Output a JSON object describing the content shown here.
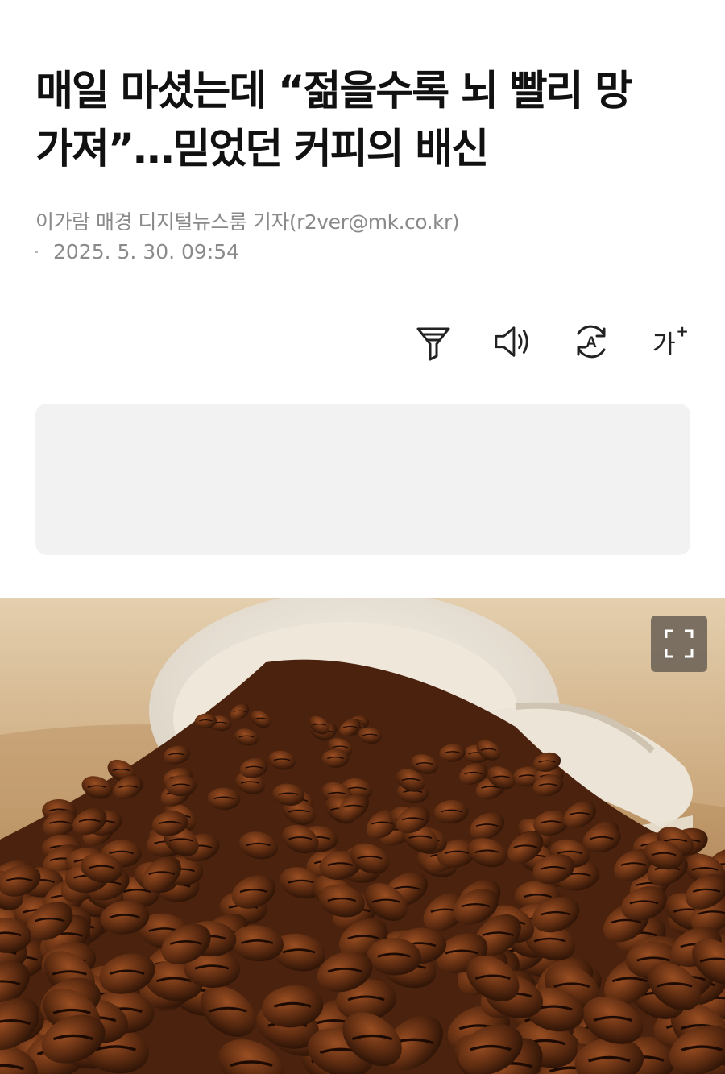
{
  "article": {
    "headline_line1": "매일 마셨는데 “젊을수록 뇌 빨리 망",
    "headline_line2": "가져”…믿었던 커피의 배신",
    "byline": "이가람 매경 디지털뉴스룸 기자(r2ver@mk.co.kr)",
    "date": "2025. 5. 30. 09:54"
  },
  "toolbar": {
    "icons": [
      "filter-icon",
      "speaker-icon",
      "translate-icon",
      "font-size-icon"
    ],
    "font_size_label": "가",
    "font_size_plus": "+",
    "translate_glyph": "A"
  },
  "image": {
    "expand_icon": "expand-icon"
  },
  "colors": {
    "text": "#111111",
    "meta": "#8a8a8a",
    "ad_background": "#f2f2f2",
    "expand_button": "#695f55"
  }
}
